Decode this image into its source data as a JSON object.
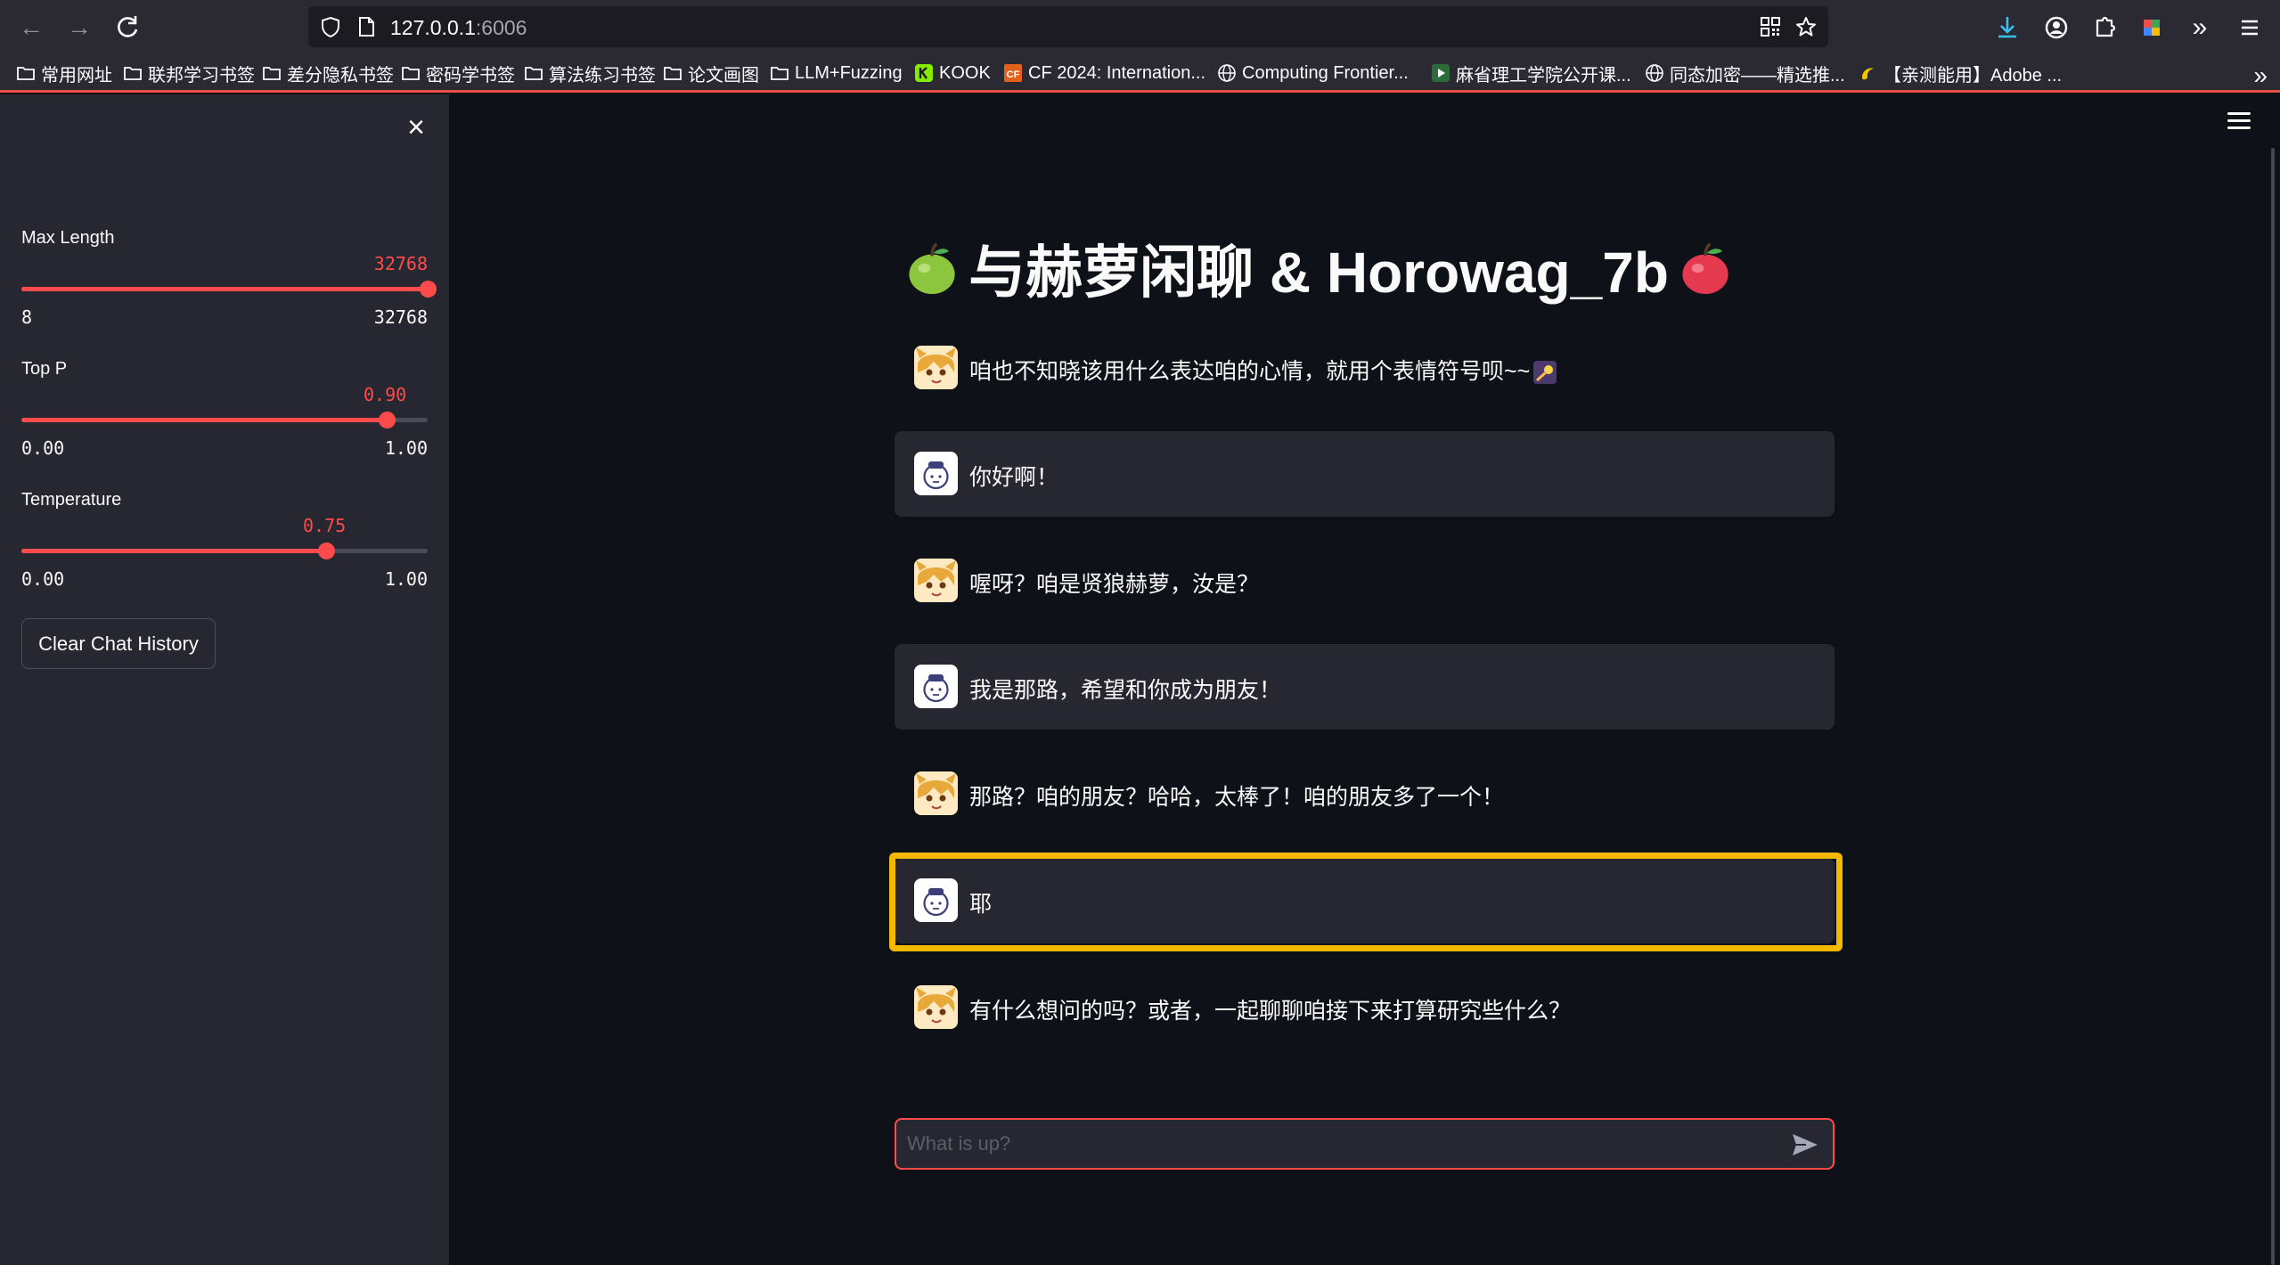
{
  "browser": {
    "url_host": "127.0.0.1",
    "url_port": ":6006",
    "bookmarks": [
      {
        "label": "常用网址",
        "icon": "folder-icon"
      },
      {
        "label": "联邦学习书签",
        "icon": "folder-icon"
      },
      {
        "label": "差分隐私书签",
        "icon": "folder-icon"
      },
      {
        "label": "密码学书签",
        "icon": "folder-icon"
      },
      {
        "label": "算法练习书签",
        "icon": "folder-icon"
      },
      {
        "label": "论文画图",
        "icon": "folder-icon"
      },
      {
        "label": "LLM+Fuzzing",
        "icon": "folder-icon"
      },
      {
        "label": "KOOK",
        "icon": "kook-icon"
      },
      {
        "label": "CF 2024: Internation...",
        "icon": "cf-icon"
      },
      {
        "label": "Computing Frontier...",
        "icon": "globe-icon"
      },
      {
        "label": "麻省理工学院公开课...",
        "icon": "play-icon"
      },
      {
        "label": "同态加密——精选推...",
        "icon": "globe-icon"
      },
      {
        "label": "【亲测能用】Adobe ...",
        "icon": "adobe-icon"
      }
    ]
  },
  "sidebar": {
    "sliders": [
      {
        "label": "Max Length",
        "value": "32768",
        "min": "8",
        "max": "32768",
        "fraction": 1.0
      },
      {
        "label": "Top P",
        "value": "0.90",
        "min": "0.00",
        "max": "1.00",
        "fraction": 0.9
      },
      {
        "label": "Temperature",
        "value": "0.75",
        "min": "0.00",
        "max": "1.00",
        "fraction": 0.75
      }
    ],
    "clear_button": "Clear Chat History"
  },
  "main": {
    "title": "与赫萝闲聊 & Horowag_7b",
    "messages": [
      {
        "role": "assistant",
        "text": "咱也不知晓该用什么表达咱的心情，就用个表情符号呗~~"
      },
      {
        "role": "user",
        "text": "你好啊！"
      },
      {
        "role": "assistant",
        "text": "喔呀？咱是贤狼赫萝，汝是？"
      },
      {
        "role": "user",
        "text": "我是那路，希望和你成为朋友！"
      },
      {
        "role": "assistant",
        "text": "那路？咱的朋友？哈哈，太棒了！咱的朋友多了一个！"
      },
      {
        "role": "user",
        "text": "耶"
      },
      {
        "role": "assistant",
        "text": "有什么想问的吗？或者，一起聊聊咱接下来打算研究些什么？"
      }
    ],
    "chat_placeholder": "What is up?"
  },
  "colors": {
    "accent": "#ff4b4b",
    "highlight": "#f5b800",
    "sidebar_bg": "#262730",
    "main_bg": "#0e1117"
  }
}
